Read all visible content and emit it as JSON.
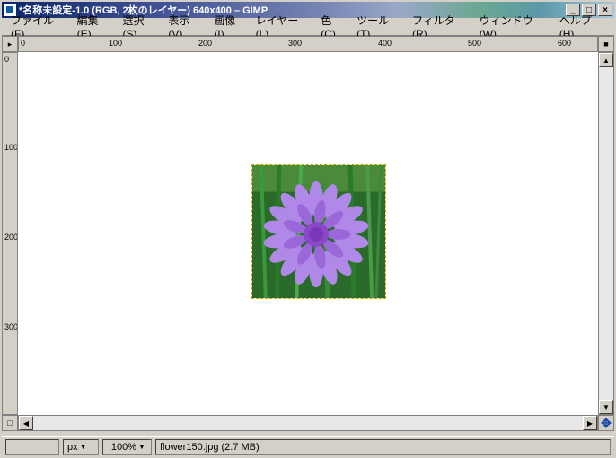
{
  "title": "*名称未設定-1.0 (RGB, 2枚のレイヤー) 640x400 – GIMP",
  "menu": {
    "file": "ファイル(F)",
    "edit": "編集(E)",
    "select": "選択(S)",
    "view": "表示(V)",
    "image": "画像(I)",
    "layer": "レイヤー(L)",
    "colors": "色(C)",
    "tools": "ツール(T)",
    "filters": "フィルタ(R)",
    "windows": "ウィンドウ(W)",
    "help": "ヘルプ(H)"
  },
  "hruler": [
    "0",
    "100",
    "200",
    "300",
    "400",
    "500",
    "600"
  ],
  "vruler": [
    "0",
    "100",
    "200",
    "300"
  ],
  "status": {
    "unit": "px",
    "zoom": "100%",
    "file": "flower150.jpg (2.7 MB)"
  },
  "winbtns": {
    "min": "_",
    "max": "□",
    "close": "×"
  }
}
